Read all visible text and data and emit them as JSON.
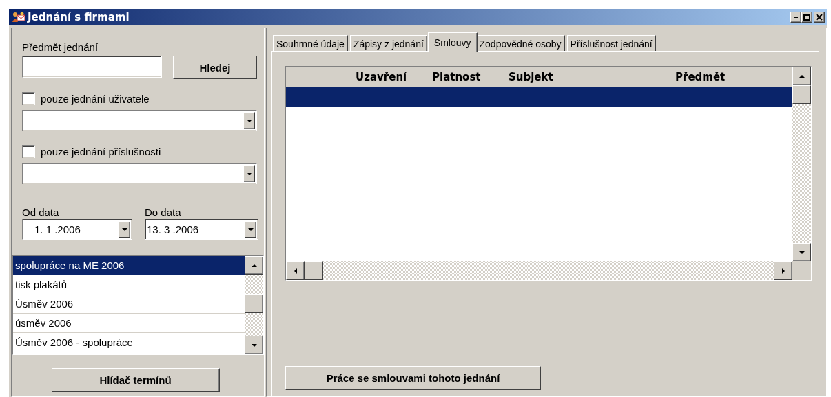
{
  "window": {
    "title": "Jednání s firmami"
  },
  "search": {
    "label": "Předmět jednání",
    "button": "Hledej"
  },
  "filters": [
    {
      "label": "pouze jednání uživatele",
      "checked": false
    },
    {
      "label": "pouze jednání příslušnosti",
      "checked": false
    }
  ],
  "dates": [
    {
      "label": "Od data",
      "value": "1. 1 .2006"
    },
    {
      "label": "Do data",
      "value": "13. 3 .2006"
    }
  ],
  "list": {
    "items": [
      {
        "text": "spolupráce na ME 2006",
        "selected": true
      },
      {
        "text": "tisk plakátů",
        "selected": false
      },
      {
        "text": "Úsměv 2006",
        "selected": false
      },
      {
        "text": "úsměv 2006",
        "selected": false
      },
      {
        "text": "Úsměv 2006 - spolupráce",
        "selected": false
      }
    ]
  },
  "watch_button": "Hlídač termínů",
  "tabs": [
    {
      "label": "Souhrnné údaje",
      "selected": false
    },
    {
      "label": "Zápisy z jednání",
      "selected": false
    },
    {
      "label": "Smlouvy",
      "selected": true
    },
    {
      "label": "Zodpovědné osoby",
      "selected": false
    },
    {
      "label": "Příslušnost jednání",
      "selected": false
    }
  ],
  "table": {
    "columns": [
      "Uzavření",
      "Platnost",
      "Subjekt",
      "Předmět"
    ],
    "rows": [
      {
        "selected": true
      }
    ]
  },
  "contracts_button": "Práce se smlouvami tohoto jednání"
}
